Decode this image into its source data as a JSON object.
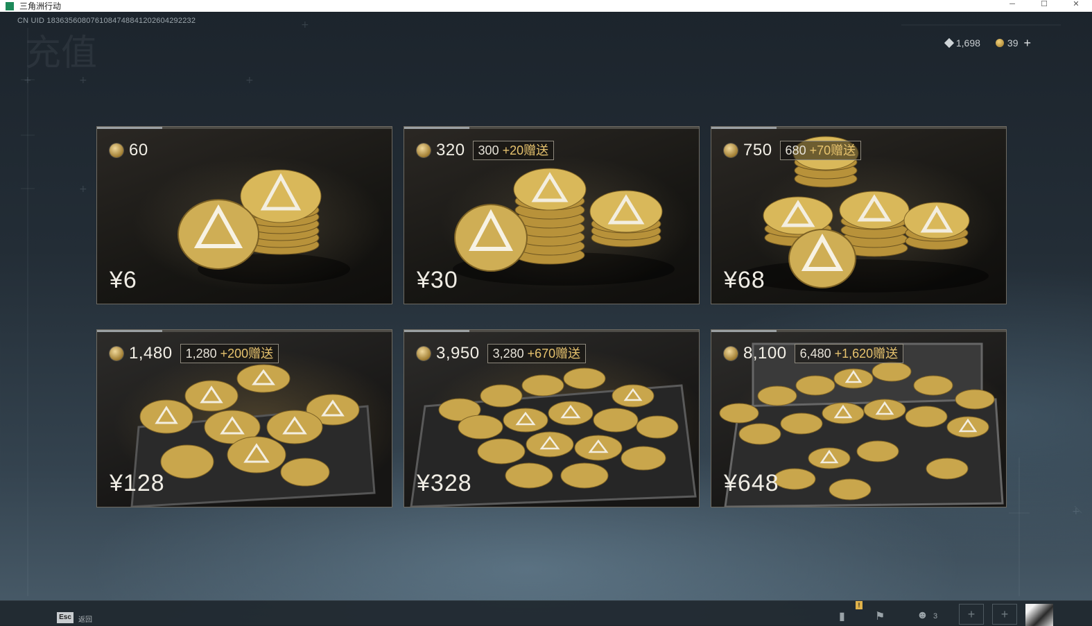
{
  "window": {
    "title": "三角洲行动",
    "minimize": "─",
    "maximize": "☐",
    "close": "✕"
  },
  "uid_text": "CN UID 1836356080761084748841202604292232",
  "page_title": "充值",
  "currency": {
    "tickets": "1,698",
    "coins": "39",
    "add": "+"
  },
  "packages": [
    {
      "amount": "60",
      "base": "",
      "bonus": "",
      "price": "¥6"
    },
    {
      "amount": "320",
      "base": "300",
      "bonus": "+20赠送",
      "price": "¥30"
    },
    {
      "amount": "750",
      "base": "680",
      "bonus": "+70赠送",
      "price": "¥68"
    },
    {
      "amount": "1,480",
      "base": "1,280",
      "bonus": "+200赠送",
      "price": "¥128"
    },
    {
      "amount": "3,950",
      "base": "3,280",
      "bonus": "+670赠送",
      "price": "¥328"
    },
    {
      "amount": "8,100",
      "base": "6,480",
      "bonus": "+1,620赠送",
      "price": "¥648"
    }
  ],
  "bottom": {
    "esc_key": "Esc",
    "back_label": "返回",
    "alert": "!",
    "friends_count": "3"
  }
}
